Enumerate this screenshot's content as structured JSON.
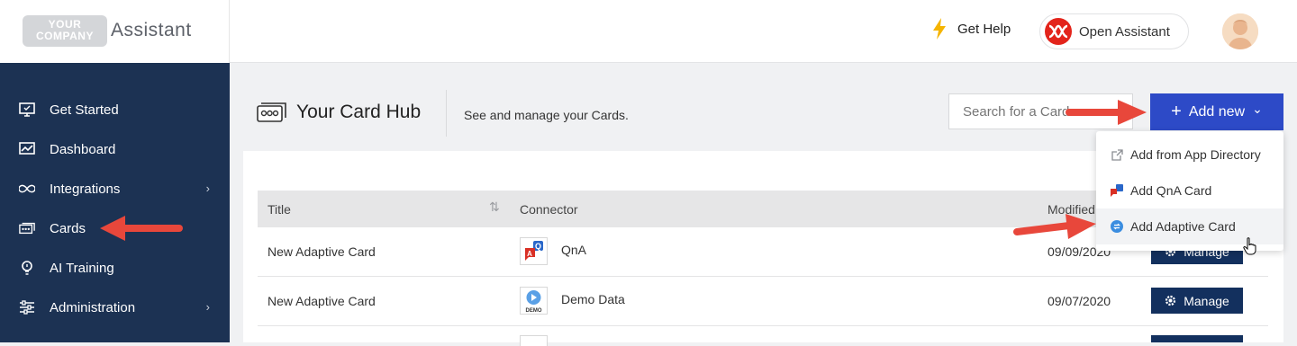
{
  "brand": {
    "logo_line1": "YOUR",
    "logo_line2": "COMPANY",
    "name": "Assistant"
  },
  "sidebar": {
    "items": [
      {
        "label": "Get Started",
        "icon": "monitor-icon",
        "chevron": false
      },
      {
        "label": "Dashboard",
        "icon": "chart-icon",
        "chevron": false
      },
      {
        "label": "Integrations",
        "icon": "infinity-icon",
        "chevron": true
      },
      {
        "label": "Cards",
        "icon": "cards-icon",
        "chevron": false
      },
      {
        "label": "AI Training",
        "icon": "lightbulb-icon",
        "chevron": false
      },
      {
        "label": "Administration",
        "icon": "sliders-icon",
        "chevron": true
      }
    ],
    "chevron_glyph": "›"
  },
  "header": {
    "help_label": "Get Help",
    "open_assistant_label": "Open Assistant"
  },
  "hub": {
    "title": "Your Card Hub",
    "subtitle": "See and manage your Cards.",
    "search_placeholder": "Search for a Card",
    "add_new_label": "Add new",
    "add_new_plus": "+",
    "add_new_caret": "⌄"
  },
  "dropdown": {
    "items": [
      {
        "label": "Add from App Directory",
        "icon": "external-link-icon"
      },
      {
        "label": "Add QnA Card",
        "icon": "qna-icon"
      },
      {
        "label": "Add Adaptive Card",
        "icon": "adaptive-card-icon"
      }
    ]
  },
  "table": {
    "columns": [
      "Title",
      "Connector",
      "Modified"
    ],
    "sort_glyph": "⇅",
    "rows": [
      {
        "title": "New Adaptive Card",
        "connector": "QnA",
        "modified": "09/09/2020",
        "action": "Manage"
      },
      {
        "title": "New Adaptive Card",
        "connector": "Demo Data",
        "modified": "09/07/2020",
        "action": "Manage"
      }
    ],
    "demo_badge": "DEMO",
    "qna_badge": "Q"
  },
  "colors": {
    "sidebar_bg": "#1c3253",
    "accent": "#2d4ac7",
    "manage_bg": "#13305e",
    "annotation_arrow": "#e8473b"
  }
}
